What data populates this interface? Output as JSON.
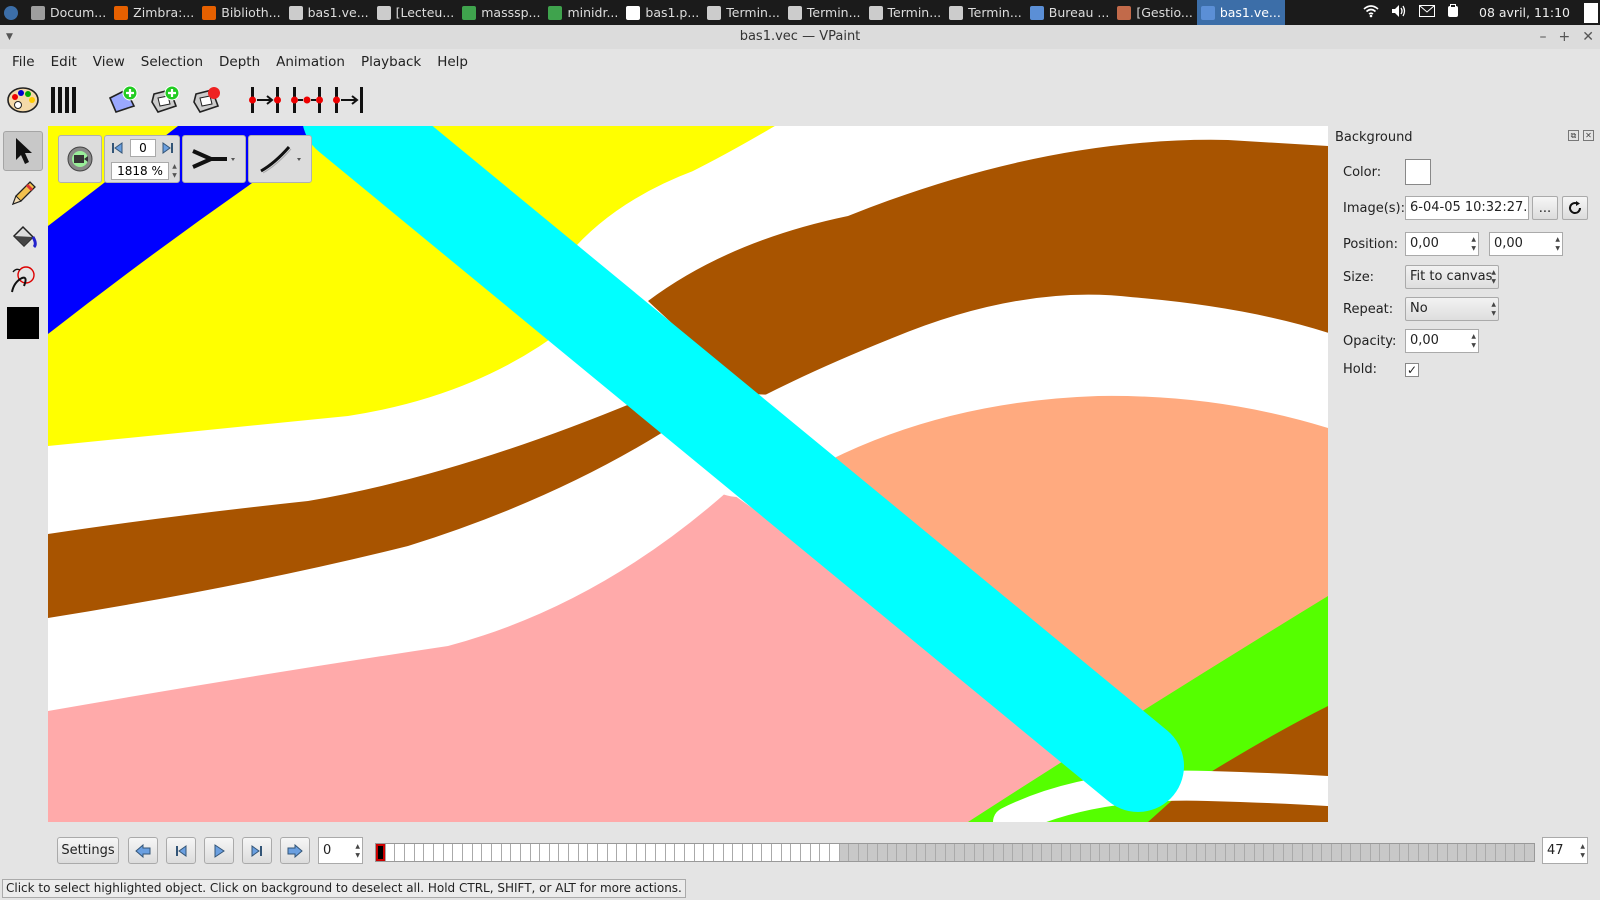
{
  "taskbar": {
    "start_icon": "kde-start-icon",
    "items": [
      {
        "label": "Docum...",
        "icon": "tex-icon",
        "color": "#9e9e9e"
      },
      {
        "label": "Zimbra:...",
        "icon": "firefox-icon",
        "color": "#e66000"
      },
      {
        "label": "Biblioth...",
        "icon": "firefox-icon",
        "color": "#e66000"
      },
      {
        "label": "bas1.ve...",
        "icon": "editor-icon",
        "color": "#cccccc"
      },
      {
        "label": "[Lecteu...",
        "icon": "terminal-icon",
        "color": "#cccccc"
      },
      {
        "label": "masssp...",
        "icon": "app-icon",
        "color": "#3fa34d"
      },
      {
        "label": "minidr...",
        "icon": "window-icon",
        "color": "#3fa34d"
      },
      {
        "label": "bas1.p...",
        "icon": "image-icon",
        "color": "#ffffff"
      },
      {
        "label": "Termin...",
        "icon": "terminal-icon",
        "color": "#cccccc"
      },
      {
        "label": "Termin...",
        "icon": "terminal-icon",
        "color": "#cccccc"
      },
      {
        "label": "Termin...",
        "icon": "terminal-icon",
        "color": "#cccccc"
      },
      {
        "label": "Termin...",
        "icon": "terminal-icon",
        "color": "#cccccc"
      },
      {
        "label": "Bureau ...",
        "icon": "desktop-icon",
        "color": "#5b8fd6"
      },
      {
        "label": "[Gestio...",
        "icon": "archive-icon",
        "color": "#c26a4a"
      },
      {
        "label": "bas1.ve...",
        "icon": "vpaint-icon",
        "color": "#5b8fd6",
        "active": true
      }
    ],
    "clock": "08 avril, 11:10"
  },
  "window": {
    "title": "bas1.vec — VPaint"
  },
  "menu": [
    "File",
    "Edit",
    "View",
    "Selection",
    "Depth",
    "Animation",
    "Playback",
    "Help"
  ],
  "overlay": {
    "frame_value": "0",
    "zoom_value": "1818 %"
  },
  "panel": {
    "title": "Background",
    "color_label": "Color:",
    "images_label": "Image(s):",
    "images_value": "6-04-05 10:32:27.png",
    "browse_label": "...",
    "position_label": "Position:",
    "position_x": "0,00",
    "position_y": "0,00",
    "size_label": "Size:",
    "size_value": "Fit to canvas",
    "repeat_label": "Repeat:",
    "repeat_value": "No",
    "opacity_label": "Opacity:",
    "opacity_value": "0,00",
    "hold_label": "Hold:",
    "hold_checked": true
  },
  "timeline": {
    "settings_label": "Settings",
    "current_frame": "0",
    "last_frame": "47",
    "total_cells": 120,
    "active_cells": 48
  },
  "status": {
    "message": "Click to select highlighted object. Click on background to deselect all. Hold CTRL, SHIFT, or ALT for more actions."
  },
  "colors": {
    "yellow": "#ffff00",
    "blue": "#0000ff",
    "cyan": "#00ffff",
    "brown": "#a85400",
    "salmon": "#ffaa7f",
    "pink": "#ffaaaa",
    "green": "#55ff00",
    "white": "#ffffff"
  }
}
